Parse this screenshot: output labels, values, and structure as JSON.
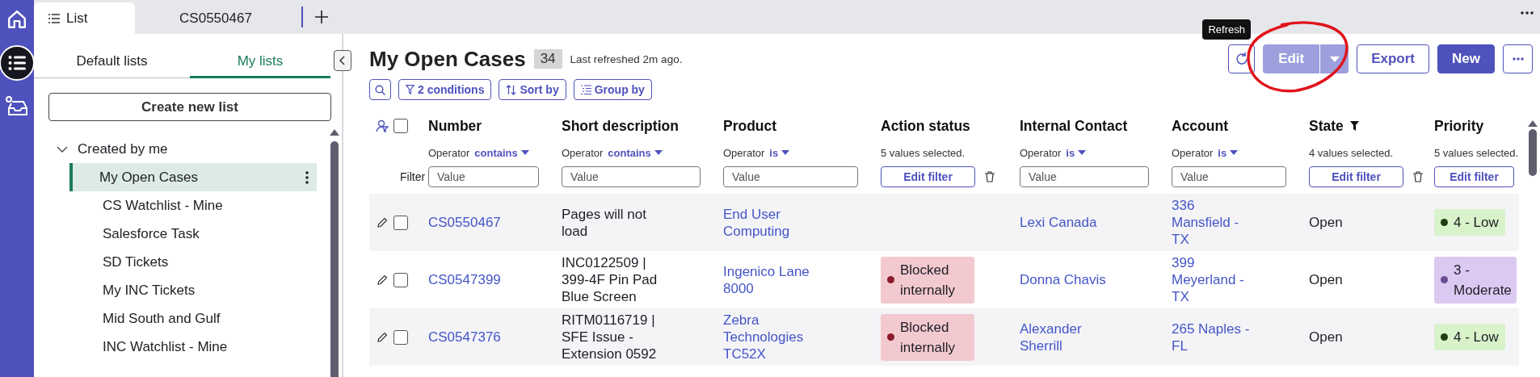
{
  "rail": {
    "items": [
      {
        "kind": "home",
        "selected": false
      },
      {
        "kind": "list",
        "selected": true
      },
      {
        "kind": "inbox",
        "selected": false
      }
    ]
  },
  "tabs": [
    {
      "label": "List",
      "selected": true
    },
    {
      "label": "CS0550467",
      "selected": false
    }
  ],
  "sidebar": {
    "tabs": [
      {
        "label": "Default lists",
        "selected": false
      },
      {
        "label": "My lists",
        "selected": true
      }
    ],
    "create_button": "Create new list",
    "group": {
      "label": "Created by me",
      "expanded": true,
      "children": [
        {
          "label": "My Open Cases",
          "selected": true
        },
        {
          "label": "CS Watchlist - Mine",
          "selected": false
        },
        {
          "label": "Salesforce Task",
          "selected": false
        },
        {
          "label": "SD Tickets",
          "selected": false
        },
        {
          "label": "My INC Tickets",
          "selected": false
        },
        {
          "label": "Mid South and Gulf",
          "selected": false
        },
        {
          "label": "INC Watchlist - Mine",
          "selected": false
        }
      ]
    }
  },
  "header": {
    "title": "My Open Cases",
    "count": "34",
    "refreshed": "Last refreshed 2m ago.",
    "tooltip": "Refresh",
    "edit": {
      "label": "Edit",
      "disabled": true
    },
    "export": "Export",
    "new": "New"
  },
  "toolbar": {
    "conditions": "2 conditions",
    "sort": "Sort by",
    "group": "Group by"
  },
  "table": {
    "select_all_checked": false,
    "filter_label": "Filter",
    "columns": [
      {
        "label": "Number",
        "filtered": false,
        "filter": {
          "kind": "operator",
          "label": "Operator",
          "operator": "contains",
          "placeholder": "Value"
        }
      },
      {
        "label": "Short description",
        "filtered": false,
        "filter": {
          "kind": "operator",
          "label": "Operator",
          "operator": "contains",
          "placeholder": "Value"
        }
      },
      {
        "label": "Product",
        "filtered": false,
        "filter": {
          "kind": "operator",
          "label": "Operator",
          "operator": "is",
          "placeholder": "Value"
        }
      },
      {
        "label": "Action status",
        "filtered": false,
        "filter": {
          "kind": "values",
          "summary": "5 values selected.",
          "button": "Edit filter",
          "clearable": true
        }
      },
      {
        "label": "Internal Contact",
        "filtered": false,
        "filter": {
          "kind": "operator",
          "label": "Operator",
          "operator": "is",
          "placeholder": "Value"
        }
      },
      {
        "label": "Account",
        "filtered": false,
        "filter": {
          "kind": "operator",
          "label": "Operator",
          "operator": "is",
          "placeholder": "Value"
        }
      },
      {
        "label": "State",
        "filtered": true,
        "filter": {
          "kind": "values",
          "summary": "4 values selected.",
          "button": "Edit filter",
          "clearable": true
        }
      },
      {
        "label": "Priority",
        "filtered": false,
        "filter": {
          "kind": "values",
          "summary": "5 values selected.",
          "button": "Edit filter",
          "clearable": false
        }
      }
    ],
    "rows": [
      {
        "checked": false,
        "cells": [
          {
            "kind": "link",
            "text": "CS0550467"
          },
          {
            "kind": "text",
            "text": "Pages will not load"
          },
          {
            "kind": "link",
            "text": "End User Computing"
          },
          null,
          {
            "kind": "link",
            "text": "Lexi Canada"
          },
          {
            "kind": "link",
            "text": "336 Mansfield - TX"
          },
          {
            "kind": "text",
            "text": "Open"
          },
          {
            "kind": "badge",
            "text": "4 - Low",
            "color": "#1f3d0f"
          }
        ]
      },
      {
        "checked": false,
        "cells": [
          {
            "kind": "link",
            "text": "CS0547399"
          },
          {
            "kind": "text",
            "text": "INC0122509 | 399-4F Pin Pad Blue Screen"
          },
          {
            "kind": "link",
            "text": "Ingenico Lane 8000"
          },
          {
            "kind": "badge",
            "text": "Blocked internally",
            "color": "#8b1a2b"
          },
          {
            "kind": "link",
            "text": "Donna Chavis"
          },
          {
            "kind": "link",
            "text": "399 Meyerland - TX"
          },
          {
            "kind": "text",
            "text": "Open"
          },
          {
            "kind": "badge",
            "text": "3 - Moderate",
            "color": "#6a4c93"
          }
        ]
      },
      {
        "checked": false,
        "cells": [
          {
            "kind": "link",
            "text": "CS0547376"
          },
          {
            "kind": "text",
            "text": "RITM0116719 | SFE Issue - Extension 0592"
          },
          {
            "kind": "link",
            "text": "Zebra Technologies TC52X"
          },
          {
            "kind": "badge",
            "text": "Blocked internally",
            "color": "#8b1a2b"
          },
          {
            "kind": "link",
            "text": "Alexander Sherrill"
          },
          {
            "kind": "link",
            "text": "265 Naples - FL"
          },
          {
            "kind": "text",
            "text": "Open"
          },
          {
            "kind": "badge",
            "text": "4 - Low",
            "color": "#1f3d0f"
          }
        ]
      }
    ]
  }
}
